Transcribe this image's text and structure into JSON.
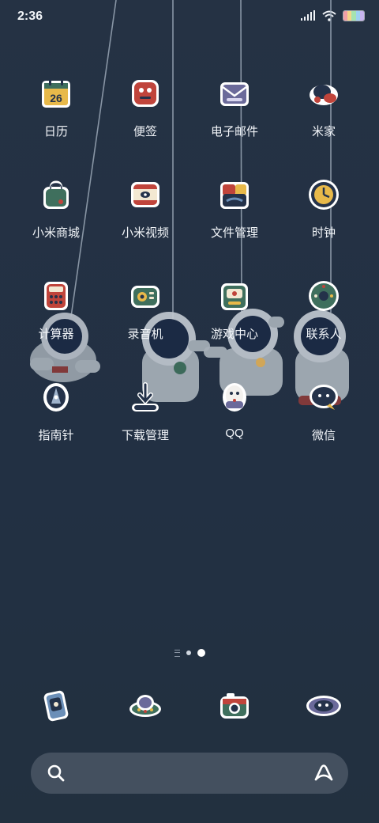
{
  "status_bar": {
    "time": "2:36"
  },
  "apps": [
    {
      "label": "日历",
      "icon": "calendar-icon",
      "icon_text": "26"
    },
    {
      "label": "便签",
      "icon": "notes-icon"
    },
    {
      "label": "电子邮件",
      "icon": "email-icon"
    },
    {
      "label": "米家",
      "icon": "mi-home-icon"
    },
    {
      "label": "小米商城",
      "icon": "mi-store-icon"
    },
    {
      "label": "小米视频",
      "icon": "mi-video-icon"
    },
    {
      "label": "文件管理",
      "icon": "file-manager-icon"
    },
    {
      "label": "时钟",
      "icon": "clock-icon"
    },
    {
      "label": "计算器",
      "icon": "calculator-icon"
    },
    {
      "label": "录音机",
      "icon": "recorder-icon"
    },
    {
      "label": "游戏中心",
      "icon": "game-center-icon"
    },
    {
      "label": "联系人",
      "icon": "contacts-icon"
    },
    {
      "label": "指南针",
      "icon": "compass-icon"
    },
    {
      "label": "下载管理",
      "icon": "downloads-icon"
    },
    {
      "label": "QQ",
      "icon": "qq-icon"
    },
    {
      "label": "微信",
      "icon": "wechat-icon"
    }
  ],
  "page_indicator": {
    "pages": 2,
    "current_page": 2
  },
  "dock": [
    {
      "icon": "phone-icon"
    },
    {
      "icon": "ufo-messages-icon"
    },
    {
      "icon": "camera-icon"
    },
    {
      "icon": "planet-browser-icon"
    }
  ],
  "search": {
    "placeholder": ""
  },
  "colors": {
    "background": "#243142",
    "label": "#f2f5f9",
    "search_bar": "#44505f",
    "sticker_outline": "#ffffff",
    "calendar_yellow": "#e8b94a",
    "accent_red": "#c0443b",
    "accent_green": "#3f6f5d",
    "accent_navy": "#24324a"
  }
}
